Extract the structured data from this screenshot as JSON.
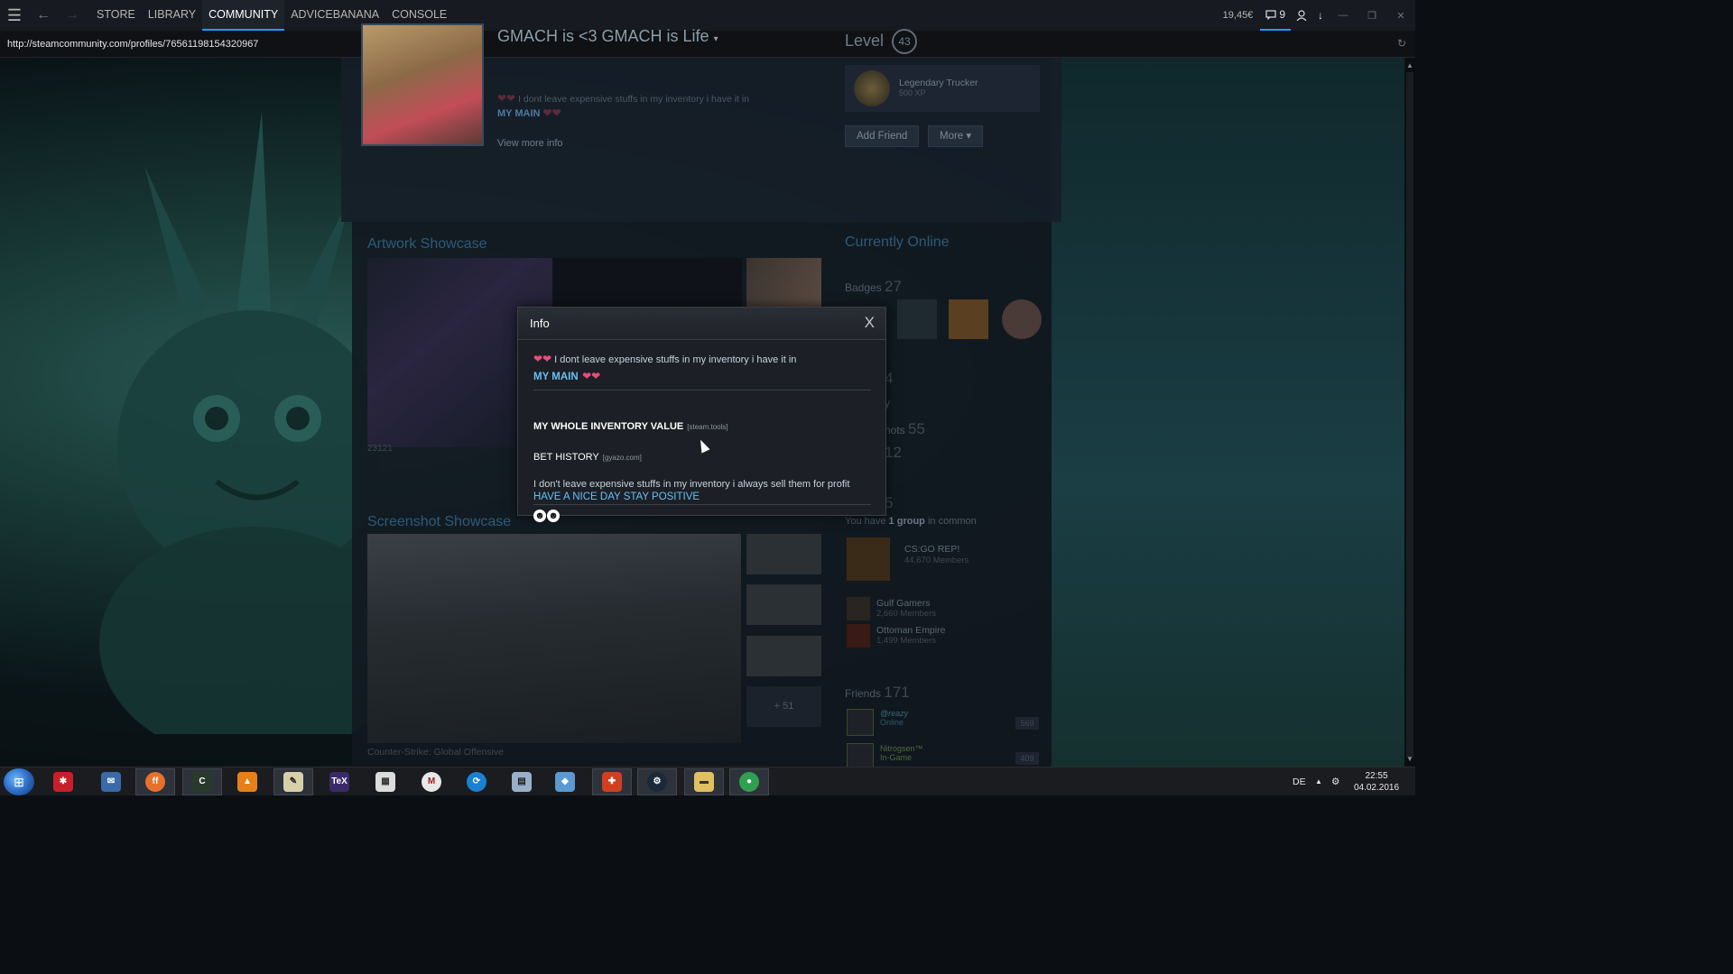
{
  "topbar": {
    "menu_icon": "hamburger-icon",
    "back_icon": "arrow-left-icon",
    "forward_icon": "arrow-right-icon",
    "menu": [
      {
        "label": "STORE",
        "active": false
      },
      {
        "label": "LIBRARY",
        "active": false
      },
      {
        "label": "COMMUNITY",
        "active": true
      },
      {
        "label": "ADVICEBANANA",
        "active": false
      },
      {
        "label": "CONSOLE",
        "active": false
      }
    ],
    "wallet": "19,45€",
    "notifications": "9"
  },
  "urlbar": {
    "url": "http://steamcommunity.com/profiles/76561198154320967"
  },
  "profile": {
    "name": "GMACH is <3 GMACH is Life",
    "summary_line1": "I dont leave expensive stuffs in my inventory i have it in",
    "summary_line2": "MY MAIN",
    "view_more": "View more info",
    "level_label": "Level",
    "level": "43",
    "badge_name": "Legendary Trucker",
    "badge_xp": "500 XP",
    "add_friend": "Add Friend",
    "more": "More",
    "status": "Currently Online",
    "badges_label": "Badges",
    "badges_count": "27",
    "partial_a": "4",
    "partial_b": "y",
    "partial_c": "hots",
    "partial_d": "55",
    "partial_e": "12",
    "partial_f": "5",
    "groups_line_pre": "You have",
    "groups_line_bold": "1 group",
    "groups_line_post": "in common",
    "groups": [
      {
        "name": "CS:GO REP!",
        "members": "44,670 Members"
      },
      {
        "name": "Gulf Gamers",
        "members": "2,660 Members"
      },
      {
        "name": "Ottoman Empire",
        "members": "1,499 Members"
      }
    ],
    "friends_label": "Friends",
    "friends_count": "171",
    "friends": [
      {
        "name": "@reazy",
        "status": "Online",
        "level": "569"
      },
      {
        "name": "Nitrogsen™",
        "status": "In-Game",
        "level": "409"
      }
    ]
  },
  "showcases": {
    "artwork_title": "Artwork Showcase",
    "artwork_caption": "23121",
    "screenshot_title": "Screenshot Showcase",
    "screenshot_more": "+ 51",
    "screenshot_caption": "Counter-Strike: Global Offensive"
  },
  "dialog": {
    "title": "Info",
    "close": "X",
    "line1": "I dont leave expensive stuffs in my inventory i have it in",
    "line2": "MY MAIN",
    "inv_label": "MY WHOLE INVENTORY VALUE",
    "inv_source": "[steam.tools]",
    "bet_label": "BET HISTORY",
    "bet_source": "[gyazo.com]",
    "line3": "I don't leave expensive stuffs in my inventory i always sell them for profit",
    "line4": "HAVE A NICE DAY STAY POSITIVE"
  },
  "taskbar": {
    "lang": "DE",
    "time": "22:55",
    "date": "04.02.2016"
  },
  "colors": {
    "accent": "#1a9fff",
    "link": "#66c0f4",
    "heart": "#e84e7a"
  }
}
